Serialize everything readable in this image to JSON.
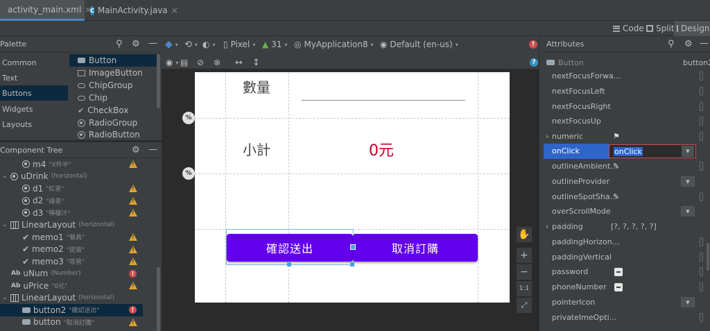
{
  "tabs": [
    {
      "label": "activity_main.xml",
      "active": true
    },
    {
      "label": "MainActivity.java",
      "active": false
    }
  ],
  "tab_close": "×",
  "modes": {
    "code": "Code",
    "split": "Split",
    "design": "Design"
  },
  "palette": {
    "title": "Palette",
    "categories": [
      "Common",
      "Text",
      "Buttons",
      "Widgets",
      "Layouts"
    ],
    "items": [
      "Button",
      "ImageButton",
      "ChipGroup",
      "Chip",
      "CheckBox",
      "RadioGroup",
      "RadioButton"
    ]
  },
  "tree": {
    "title": "Component Tree",
    "rows": [
      {
        "name": "m4",
        "sub": "\"X件半\""
      },
      {
        "name": "uDrink",
        "sub": "(horizontal)"
      },
      {
        "name": "d1",
        "sub": "\"紅茶\""
      },
      {
        "name": "d2",
        "sub": "\"綠茶\""
      },
      {
        "name": "d3",
        "sub": "\"檸檬汁\""
      },
      {
        "name": "LinearLayout",
        "sub": "(horizontal)"
      },
      {
        "name": "memo1",
        "sub": "\"餐具\""
      },
      {
        "name": "memo2",
        "sub": "\"提袋\""
      },
      {
        "name": "memo3",
        "sub": "\"吸管\""
      },
      {
        "name": "uNum",
        "sub": "(Number)"
      },
      {
        "name": "uPrice",
        "sub": "\"0元\""
      },
      {
        "name": "LinearLayout",
        "sub": "(horizontal)"
      },
      {
        "name": "button2",
        "sub": "\"確認送出\""
      },
      {
        "name": "button",
        "sub": "\"取消訂購\""
      }
    ]
  },
  "toolbar": {
    "device": "Pixel",
    "api": "31",
    "theme": "MyApplication8",
    "locale": "Default (en-us)"
  },
  "preview": {
    "qty_label": "數量",
    "subtotal_label": "小計",
    "price": "0元",
    "confirm_button": "確認送出",
    "cancel_button": "取消訂購",
    "pct": "%"
  },
  "zoom": {
    "plus": "+",
    "minus": "−",
    "one": "1:1"
  },
  "attributes": {
    "title": "Attributes",
    "widget": "Button",
    "id": "button2",
    "rows": [
      {
        "name": "nextFocusForwa...",
        "value": ""
      },
      {
        "name": "nextFocusLeft",
        "value": ""
      },
      {
        "name": "nextFocusRight",
        "value": ""
      },
      {
        "name": "nextFocusUp",
        "value": ""
      },
      {
        "name": "numeric",
        "value": ""
      },
      {
        "name": "onClick",
        "value": "onClick"
      },
      {
        "name": "outlineAmbient...",
        "value": ""
      },
      {
        "name": "outlineProvider",
        "value": ""
      },
      {
        "name": "outlineSpotSha...",
        "value": ""
      },
      {
        "name": "overScrollMode",
        "value": ""
      },
      {
        "name": "padding",
        "value": "[?, ?, ?, ?, ?]"
      },
      {
        "name": "paddingHorizon...",
        "value": ""
      },
      {
        "name": "paddingVertical",
        "value": ""
      },
      {
        "name": "password",
        "value": ""
      },
      {
        "name": "phoneNumber",
        "value": ""
      },
      {
        "name": "pointerIcon",
        "value": ""
      },
      {
        "name": "privateImeOpti...",
        "value": ""
      }
    ]
  },
  "colors": {
    "accent": "#6200ee",
    "price": "#c1002a",
    "selection": "#2f65ca"
  }
}
